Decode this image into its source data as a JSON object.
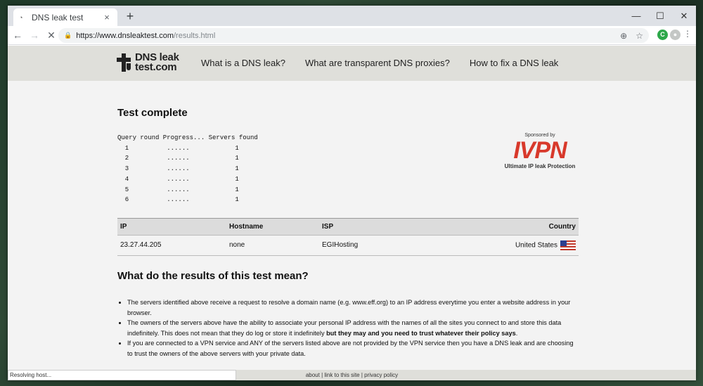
{
  "browser": {
    "tab_title": "DNS leak test",
    "tab_close": "×",
    "new_tab": "+",
    "url_host": "https://www.dnsleaktest.com",
    "url_path": "/results.html",
    "minimize": "—",
    "maximize": "☐",
    "close": "✕",
    "status_text": "Resolving host..."
  },
  "site": {
    "logo_line1": "DNS leak",
    "logo_line2": "test.com",
    "nav": [
      "What is a DNS leak?",
      "What are transparent DNS proxies?",
      "How to fix a DNS leak"
    ]
  },
  "results": {
    "heading": "Test complete",
    "query_header": "Query round Progress... Servers found",
    "query_rows": [
      "  1          ......            1",
      "  2          ......            1",
      "  3          ......            1",
      "  4          ......            1",
      "  5          ......            1",
      "  6          ......            1"
    ],
    "table_headers": {
      "ip": "IP",
      "hostname": "Hostname",
      "isp": "ISP",
      "country": "Country"
    },
    "rows": [
      {
        "ip": "23.27.44.205",
        "hostname": "none",
        "isp": "EGIHosting",
        "country": "United States"
      }
    ]
  },
  "sponsor": {
    "by": "Sponsored by",
    "brand": "IVPN",
    "tagline": "Ultimate IP leak Protection",
    "brand_color": "#d8392b"
  },
  "explain": {
    "heading": "What do the results of this test mean?",
    "item1": "The servers identified above receive a request to resolve a domain name (e.g. www.eff.org) to an IP address everytime you enter a website address in your browser.",
    "item2_a": "The owners of the servers above have the ability to associate your personal IP address with the names of all the sites you connect to and store this data indefinitely. This does not mean that they do log or store it indefinitely ",
    "item2_b": "but they may and you need to trust whatever their policy says",
    "item2_c": ".",
    "item3": "If you are connected to a VPN service and ANY of the servers listed above are not provided by the VPN service then you have a DNS leak and are choosing to trust the owners of the above servers with your private data."
  },
  "footer": {
    "about": "about",
    "link": "link to this site",
    "privacy": "privacy policy",
    "sep": " | "
  }
}
